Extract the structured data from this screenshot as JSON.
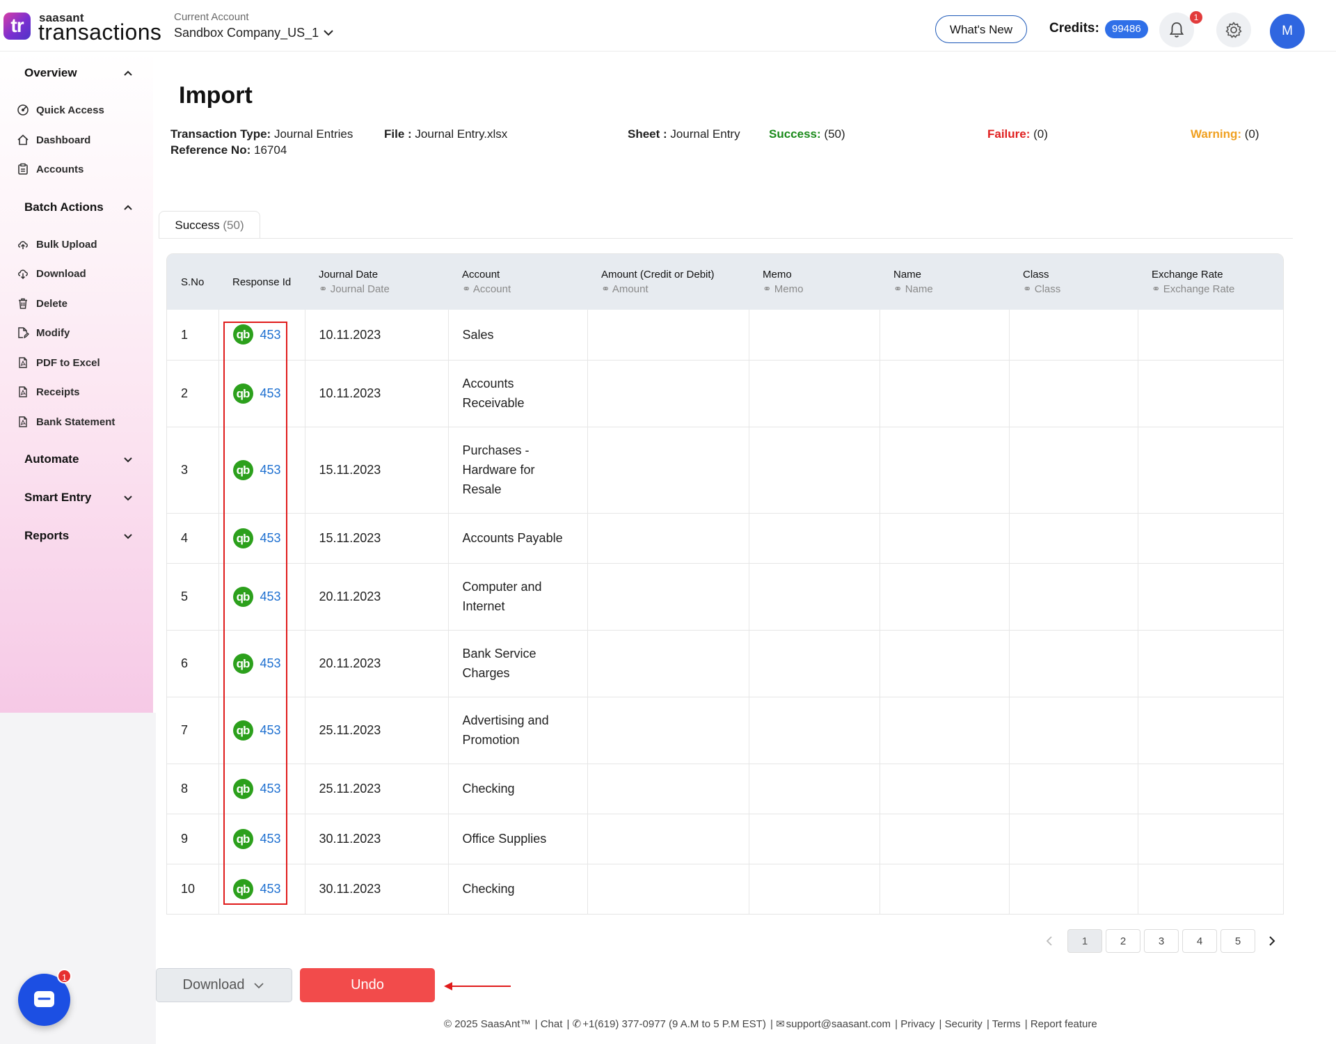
{
  "brand": {
    "logo_mark": "tr",
    "name_small": "saasant",
    "name_big": "transactions"
  },
  "account": {
    "label": "Current Account",
    "value": "Sandbox Company_US_1"
  },
  "header": {
    "whats_new": "What's New",
    "credits_label": "Credits:",
    "credits_value": "99486",
    "notification_count": "1",
    "avatar_initial": "M"
  },
  "sidebar": {
    "overview": {
      "title": "Overview",
      "items": [
        "Quick Access",
        "Dashboard",
        "Accounts"
      ]
    },
    "batch_actions": {
      "title": "Batch Actions",
      "items": [
        "Bulk Upload",
        "Download",
        "Delete",
        "Modify",
        "PDF to Excel",
        "Receipts",
        "Bank Statement"
      ]
    },
    "automate": "Automate",
    "smart_entry": "Smart Entry",
    "reports": "Reports"
  },
  "page": {
    "title": "Import",
    "transaction_type_label": "Transaction Type:",
    "transaction_type_value": "Journal Entries",
    "reference_label": "Reference No:",
    "reference_value": "16704",
    "file_label": "File :",
    "file_value": "Journal Entry.xlsx",
    "sheet_label": "Sheet :",
    "sheet_value": "Journal Entry",
    "success_label": "Success:",
    "success_value": "(50)",
    "failure_label": "Failure:",
    "failure_value": "(0)",
    "warning_label": "Warning:",
    "warning_value": "(0)"
  },
  "tab": {
    "label": "Success",
    "count": "(50)"
  },
  "table": {
    "columns": [
      {
        "title": "S.No",
        "sub": ""
      },
      {
        "title": "Response Id",
        "sub": ""
      },
      {
        "title": "Journal Date",
        "sub": "Journal Date"
      },
      {
        "title": "Account",
        "sub": "Account"
      },
      {
        "title": "Amount (Credit or Debit)",
        "sub": "Amount"
      },
      {
        "title": "Memo",
        "sub": "Memo"
      },
      {
        "title": "Name",
        "sub": "Name"
      },
      {
        "title": "Class",
        "sub": "Class"
      },
      {
        "title": "Exchange Rate",
        "sub": "Exchange Rate"
      }
    ],
    "rows": [
      {
        "sno": "1",
        "response": "453",
        "date": "10.11.2023",
        "account": "Sales"
      },
      {
        "sno": "2",
        "response": "453",
        "date": "10.11.2023",
        "account": "Accounts Receivable"
      },
      {
        "sno": "3",
        "response": "453",
        "date": "15.11.2023",
        "account": "Purchases - Hardware for Resale"
      },
      {
        "sno": "4",
        "response": "453",
        "date": "15.11.2023",
        "account": "Accounts Payable"
      },
      {
        "sno": "5",
        "response": "453",
        "date": "20.11.2023",
        "account": "Computer and Internet"
      },
      {
        "sno": "6",
        "response": "453",
        "date": "20.11.2023",
        "account": "Bank Service Charges"
      },
      {
        "sno": "7",
        "response": "453",
        "date": "25.11.2023",
        "account": "Advertising and Promotion"
      },
      {
        "sno": "8",
        "response": "453",
        "date": "25.11.2023",
        "account": "Checking"
      },
      {
        "sno": "9",
        "response": "453",
        "date": "30.11.2023",
        "account": "Office Supplies"
      },
      {
        "sno": "10",
        "response": "453",
        "date": "30.11.2023",
        "account": "Checking"
      }
    ]
  },
  "pagination": {
    "pages": [
      "1",
      "2",
      "3",
      "4",
      "5"
    ],
    "current": "1"
  },
  "actions": {
    "download": "Download",
    "undo": "Undo"
  },
  "chat": {
    "badge": "1"
  },
  "footer": {
    "copyright": "© 2025 SaasAnt™",
    "chat": "Chat",
    "phone": "+1(619) 377-0977 (9 A.M to 5 P.M EST)",
    "email": "support@saasant.com",
    "privacy": "Privacy",
    "security": "Security",
    "terms": "Terms",
    "report": "Report feature"
  },
  "colors": {
    "accent": "#2f6fe8",
    "success": "#1a8a1a",
    "failure": "#e02020",
    "warning": "#f0a020",
    "undo": "#f24b4b",
    "quickbooks": "#2ca01c"
  }
}
